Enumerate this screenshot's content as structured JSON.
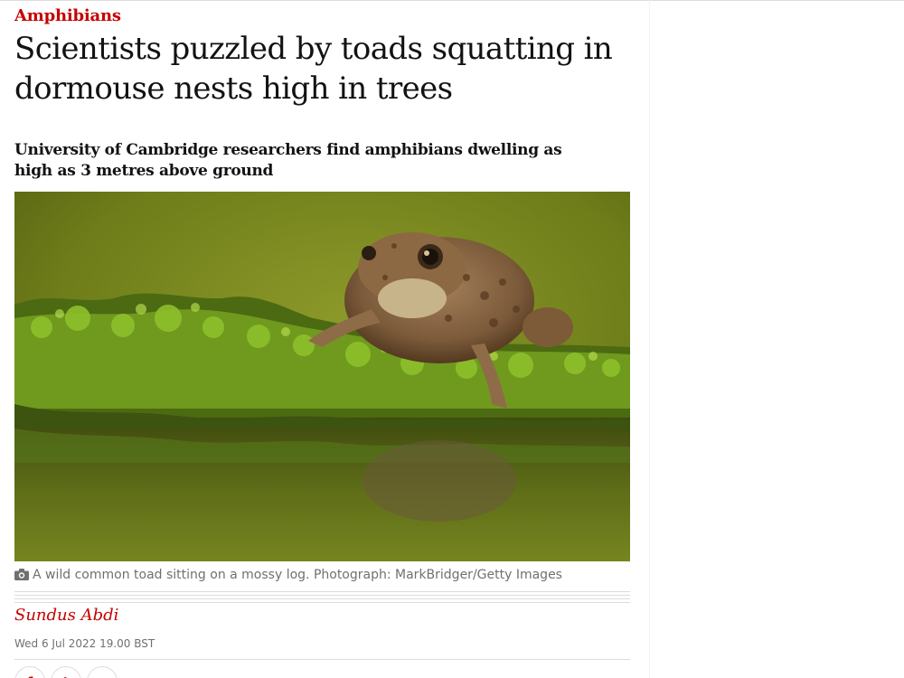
{
  "article": {
    "section": "Amphibians",
    "headline": "Scientists puzzled by toads squatting in dormouse nests high in trees",
    "standfirst": "University of Cambridge researchers find amphibians dwelling as high as 3 metres above ground",
    "image": {
      "icon": "camera-icon",
      "caption": "A wild common toad sitting on a mossy log. Photograph: MarkBridger/Getty Images"
    },
    "byline": "Sundus Abdi",
    "dateline": "Wed 6 Jul 2022 19.00 BST"
  },
  "share": {
    "buttons": [
      {
        "icon": "facebook-icon",
        "glyph": "f"
      },
      {
        "icon": "twitter-icon",
        "glyph": "t"
      },
      {
        "icon": "email-icon",
        "glyph": "✉"
      }
    ]
  },
  "colors": {
    "accent": "#c70000",
    "text": "#121212",
    "muted": "#707070",
    "rule": "#dcdcdc"
  }
}
